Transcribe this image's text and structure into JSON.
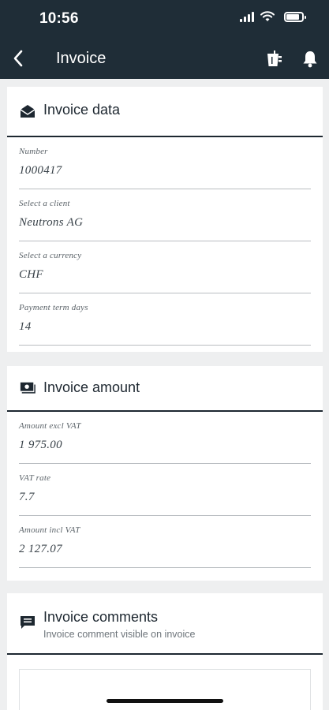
{
  "status_bar": {
    "time": "10:56"
  },
  "nav": {
    "title": "Invoice",
    "back_icon": "chevron-left-icon",
    "actions": [
      "drink-icon",
      "bell-icon"
    ]
  },
  "invoice_data": {
    "title": "Invoice data",
    "icon": "envelope-open-icon",
    "fields": [
      {
        "label": "Number",
        "value": "1000417"
      },
      {
        "label": "Select a client",
        "value": "Neutrons AG"
      },
      {
        "label": "Select a currency",
        "value": "CHF"
      },
      {
        "label": "Payment term days",
        "value": "14"
      }
    ]
  },
  "invoice_amount": {
    "title": "Invoice amount",
    "icon": "money-icon",
    "fields": [
      {
        "label": "Amount excl VAT",
        "value": "1 975.00"
      },
      {
        "label": "VAT rate",
        "value": "7.7"
      },
      {
        "label": "Amount incl VAT",
        "value": "2 127.07"
      }
    ]
  },
  "invoice_comments": {
    "title": "Invoice comments",
    "subtitle": "Invoice comment visible on invoice",
    "icon": "comment-icon"
  },
  "colors": {
    "header_bg": "#1f2d37",
    "page_bg": "#eeeff0",
    "card_bg": "#ffffff",
    "divider_dark": "#1d2730"
  }
}
